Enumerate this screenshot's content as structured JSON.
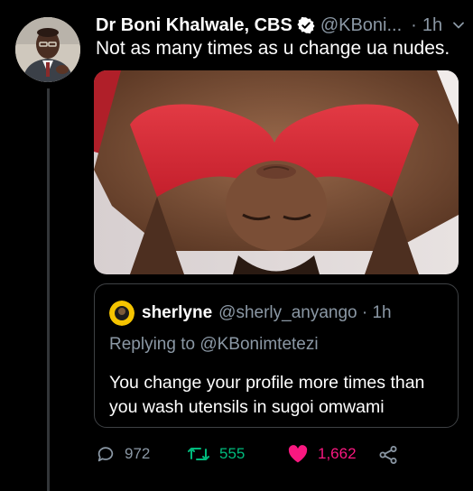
{
  "tweet": {
    "author_name": "Dr Boni Khalwale, CBS",
    "handle": "@KBoni...",
    "separator": "·",
    "time": "1h",
    "text": "Not as many times as u change ua nudes."
  },
  "quoted_tweet": {
    "author_name": "sherlyne",
    "handle_time": "@sherly_anyango · 1h",
    "replying_prefix": "Replying to",
    "replying_to": "@KBonimtetezi",
    "text": "You change your profile more times than you wash utensils in sugoi omwami"
  },
  "actions": {
    "replies": "972",
    "retweets": "555",
    "likes": "1,662"
  },
  "colors": {
    "background": "#000000",
    "secondary_text": "#8b98a5",
    "retweet_active": "#00ba7c",
    "like_active": "#f91880",
    "verified": "#ffffff"
  },
  "icons": [
    "verified-icon",
    "chevron-down-icon",
    "reply-icon",
    "retweet-icon",
    "heart-icon",
    "share-icon"
  ]
}
